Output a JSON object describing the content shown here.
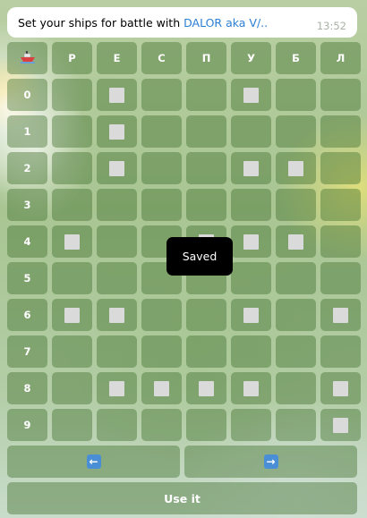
{
  "header": {
    "text": "Set your ships for battle with ",
    "link": "DALOR aka V/..",
    "time": "13:52"
  },
  "corner_icon": "ship-icon",
  "columns": [
    "Р",
    "Е",
    "С",
    "П",
    "У",
    "Б",
    "Л"
  ],
  "rows": [
    {
      "label": "0",
      "cells": [
        0,
        1,
        0,
        0,
        1,
        0,
        0
      ]
    },
    {
      "label": "1",
      "cells": [
        0,
        1,
        0,
        0,
        0,
        0,
        0
      ]
    },
    {
      "label": "2",
      "cells": [
        0,
        1,
        0,
        0,
        1,
        1,
        0
      ]
    },
    {
      "label": "3",
      "cells": [
        0,
        0,
        0,
        0,
        0,
        0,
        0
      ]
    },
    {
      "label": "4",
      "cells": [
        1,
        0,
        0,
        1,
        1,
        1,
        0
      ]
    },
    {
      "label": "5",
      "cells": [
        0,
        0,
        0,
        0,
        0,
        0,
        0
      ]
    },
    {
      "label": "6",
      "cells": [
        1,
        1,
        0,
        0,
        1,
        0,
        1
      ]
    },
    {
      "label": "7",
      "cells": [
        0,
        0,
        0,
        0,
        0,
        0,
        0
      ]
    },
    {
      "label": "8",
      "cells": [
        0,
        1,
        1,
        1,
        1,
        0,
        1
      ]
    },
    {
      "label": "9",
      "cells": [
        0,
        0,
        0,
        0,
        0,
        0,
        1
      ]
    }
  ],
  "nav": {
    "prev_icon": "left-arrow-icon",
    "next_icon": "right-arrow-icon"
  },
  "use_button": "Use it",
  "toast": "Saved"
}
